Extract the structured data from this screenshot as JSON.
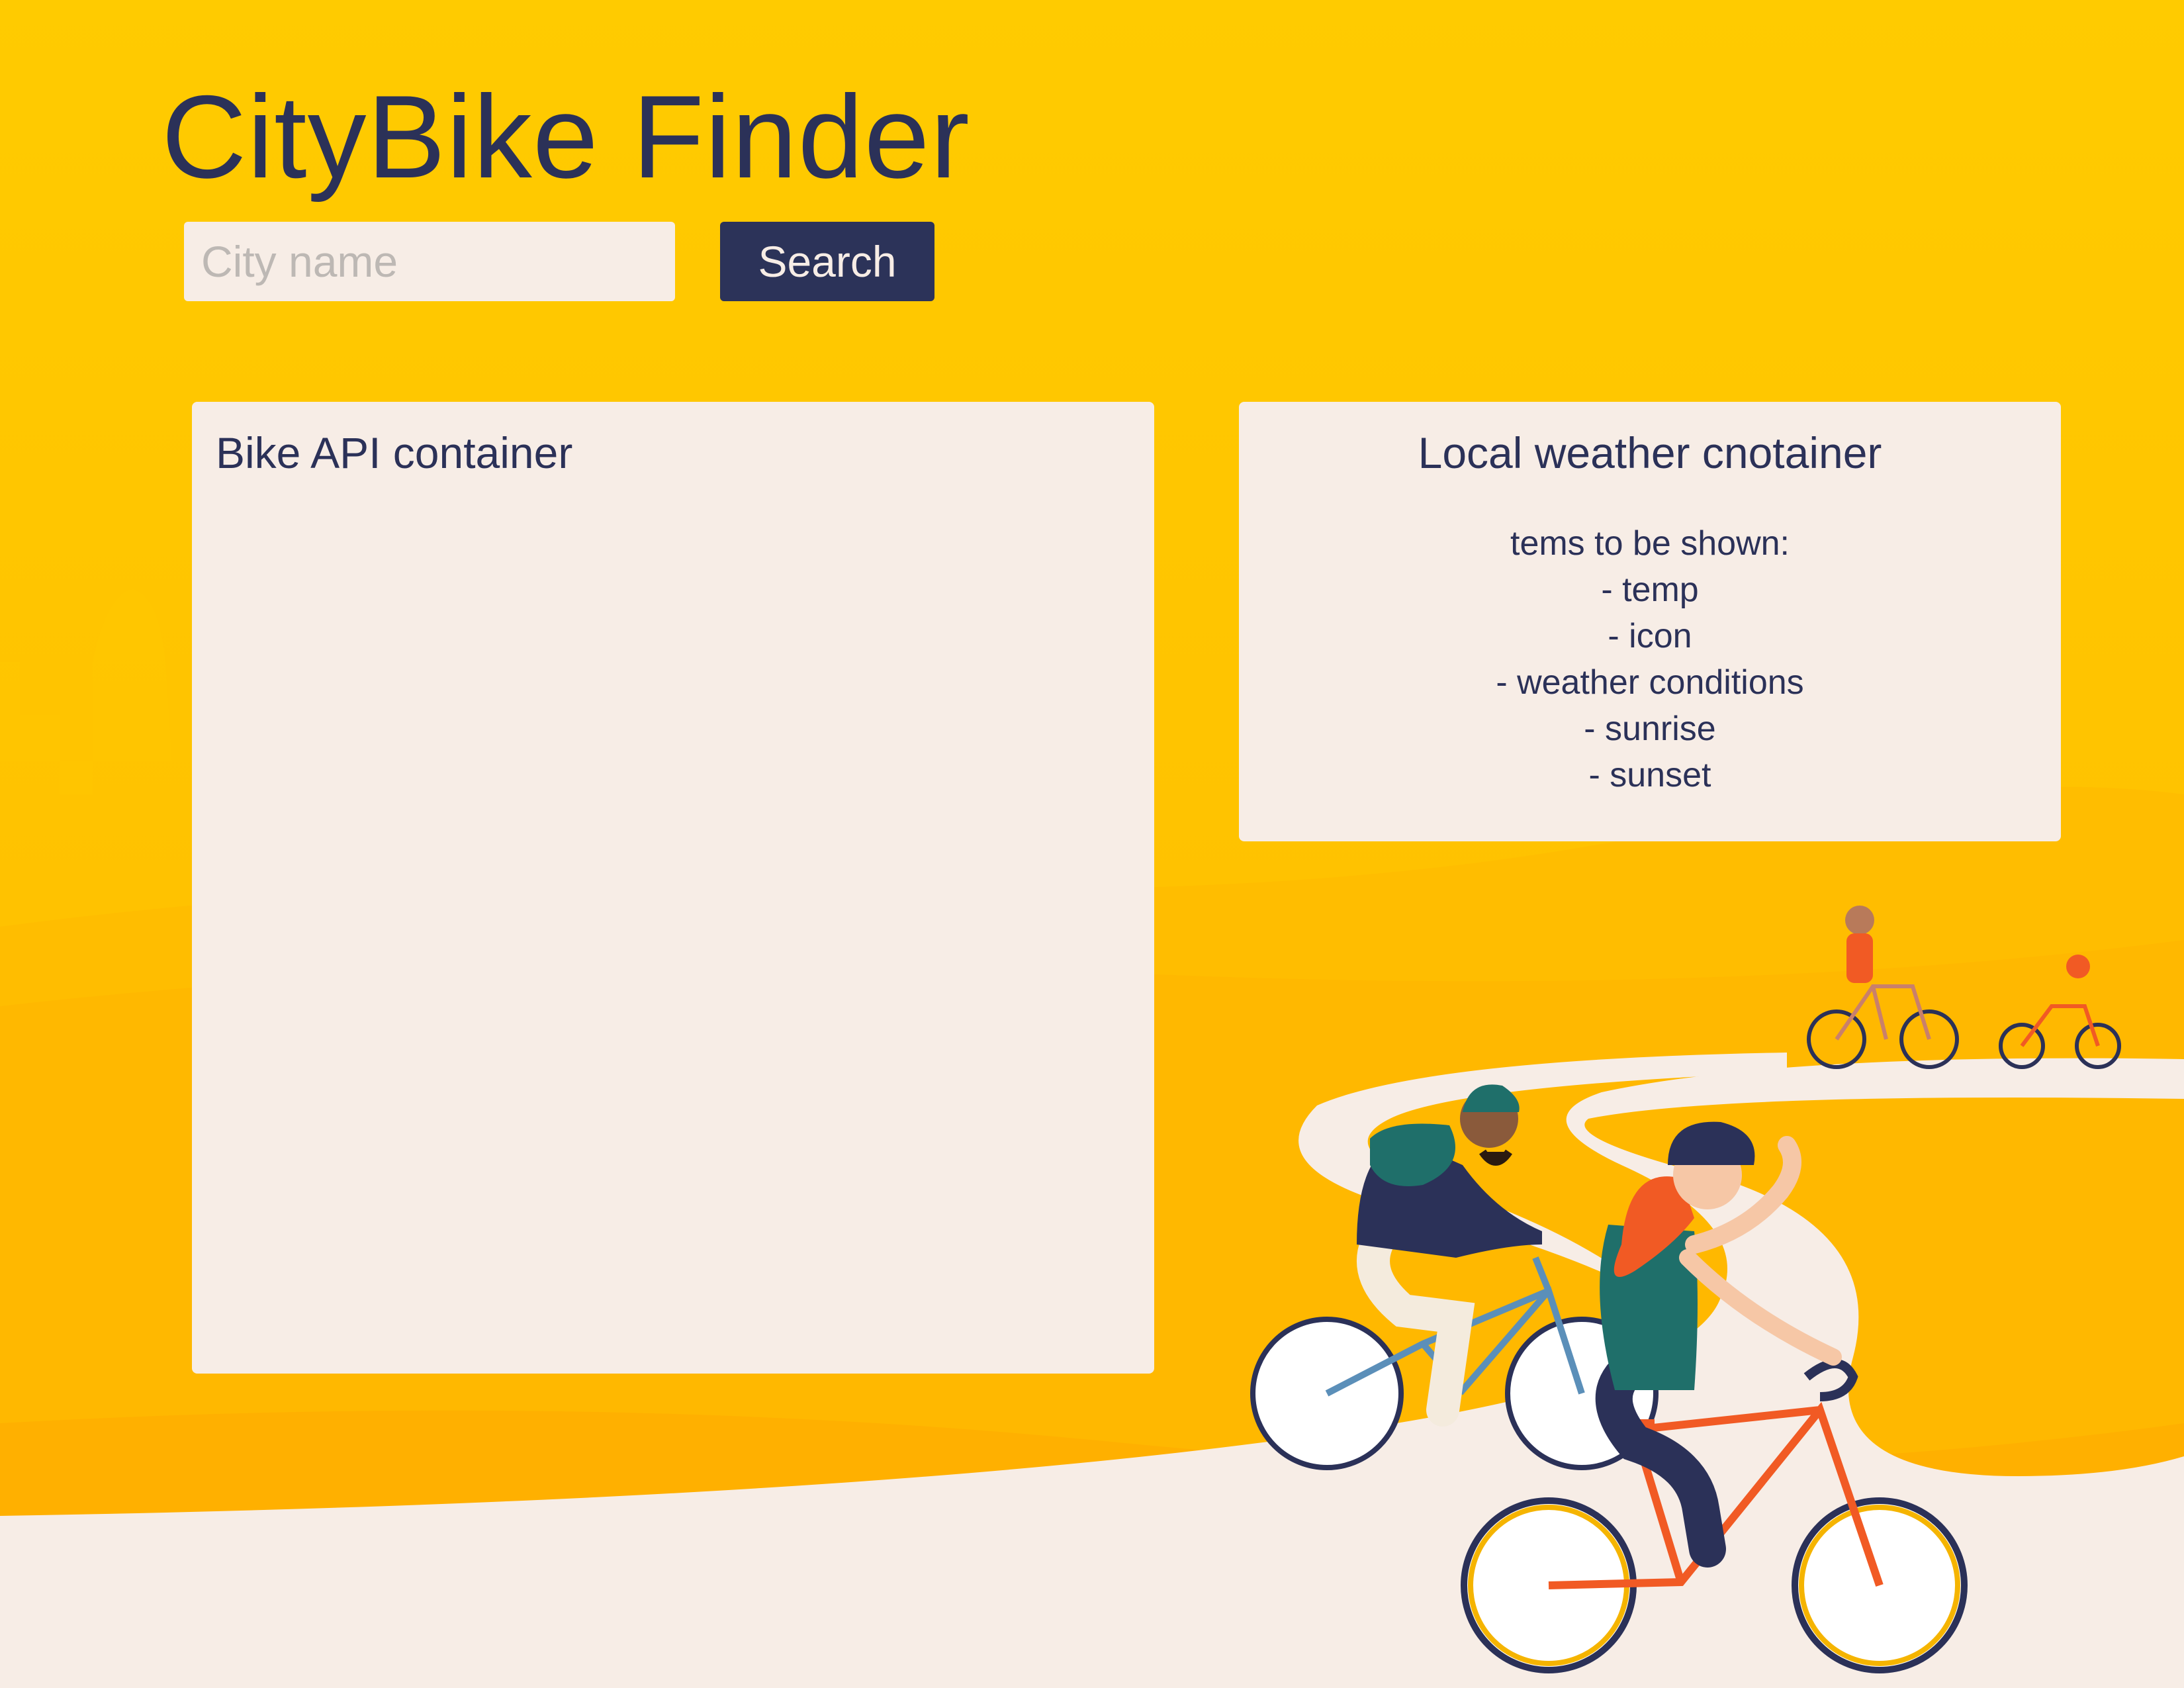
{
  "header": {
    "title": "CityBike Finder"
  },
  "search": {
    "placeholder": "City name",
    "value": "",
    "button_label": "Search"
  },
  "bike_panel": {
    "title": "Bike API container"
  },
  "weather_panel": {
    "title": "Local weather cnotainer",
    "intro": "tems to be shown:",
    "items": [
      "- temp",
      "- icon",
      "- weather conditions",
      "- sunrise",
      "- sunset"
    ]
  },
  "colors": {
    "background": "#FFC400",
    "panel": "#F7EDE6",
    "text": "#2B3158",
    "button": "#2C3359"
  }
}
